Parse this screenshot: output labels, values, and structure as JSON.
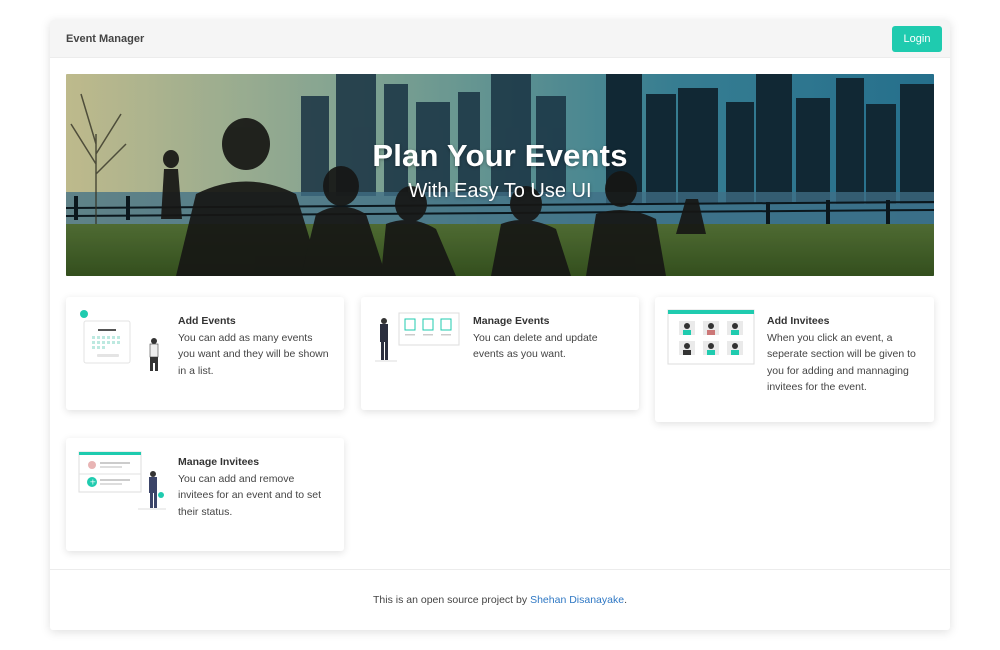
{
  "navbar": {
    "brand": "Event Manager",
    "login_label": "Login"
  },
  "hero": {
    "title": "Plan Your Events",
    "subtitle": "With Easy To Use UI"
  },
  "cards": [
    {
      "title": "Add Events",
      "text": "You can add as many events you want and they will be shown in a list.",
      "icon": "calendar-illustration"
    },
    {
      "title": "Manage Events",
      "text": "You can delete and update events as you want.",
      "icon": "board-illustration"
    },
    {
      "title": "Add Invitees",
      "text": "When you click an event, a seperate section will be given to you for adding and mannaging invitees for the event.",
      "icon": "people-grid-illustration"
    },
    {
      "title": "Manage Invitees",
      "text": "You can add and remove invitees for an event and to set their status.",
      "icon": "list-illustration"
    }
  ],
  "footer": {
    "text": "This is an open source project by",
    "author": "Shehan Disanayake",
    "suffix": "."
  },
  "colors": {
    "accent": "#1fcbaf",
    "link": "#2f78c4"
  }
}
